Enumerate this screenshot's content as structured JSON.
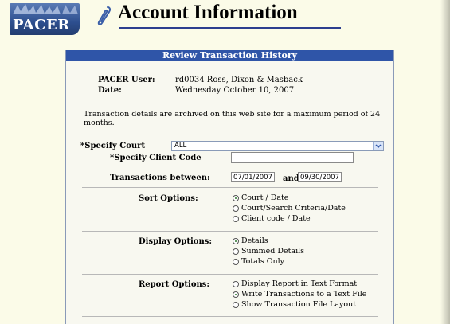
{
  "header": {
    "logo_text": "PACER",
    "title": "Account Information"
  },
  "panel": {
    "heading": "Review Transaction History",
    "user_label": "PACER User:",
    "user_value": "rd0034 Ross, Dixon & Masback",
    "date_label": "Date:",
    "date_value": "Wednesday October 10, 2007",
    "archive_note": "Transaction details are archived on this web site for a maximum period of 24 months."
  },
  "form": {
    "court_label": "*Specify Court",
    "court_value": "ALL",
    "client_label": "*Specify Client Code",
    "client_value": "",
    "between_label": "Transactions between:",
    "from_date": "07/01/2007",
    "and_label": "and",
    "to_date": "09/30/2007"
  },
  "sort": {
    "label": "Sort Options:",
    "options": [
      "Court / Date",
      "Court/Search Criteria/Date",
      "Client code / Date"
    ],
    "selected": 0
  },
  "display": {
    "label": "Display Options:",
    "options": [
      "Details",
      "Summed Details",
      "Totals Only"
    ],
    "selected": 0
  },
  "report": {
    "label": "Report Options:",
    "options": [
      "Display Report in Text Format",
      "Write Transactions to a Text File",
      "Show Transaction File Layout"
    ],
    "selected": 1
  },
  "colors": {
    "panel_header": "#2f55a8",
    "background": "#fbfbe8",
    "title_underline": "#2d3f8f"
  }
}
